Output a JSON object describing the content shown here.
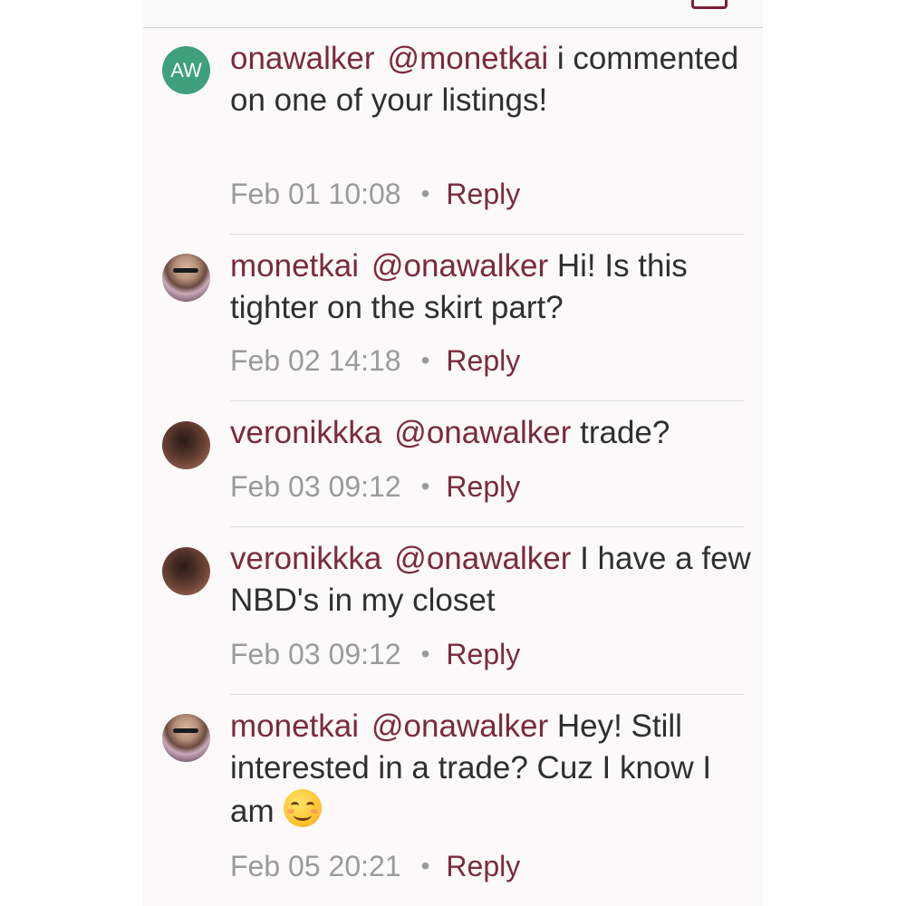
{
  "colors": {
    "accent": "#7a2a3e",
    "text": "#2f2f2f",
    "meta": "#9a9a9a",
    "avatar_initials_bg": "#3fa07e"
  },
  "header": {
    "icon": "box-icon"
  },
  "comments": [
    {
      "avatar": "AW",
      "username": "onawalker",
      "mention": "@monetkai",
      "message": "i commented on one of your listings!",
      "timestamp": "Feb 01 10:08",
      "reply_label": "Reply"
    },
    {
      "avatar": "user-photo",
      "username": "monetkai",
      "mention": "@onawalker",
      "message": "Hi! Is this tighter on the skirt part?",
      "timestamp": "Feb 02 14:18",
      "reply_label": "Reply"
    },
    {
      "avatar": "user-photo",
      "username": "veronikkka",
      "mention": "@onawalker",
      "message": "trade?",
      "timestamp": "Feb 03 09:12",
      "reply_label": "Reply"
    },
    {
      "avatar": "user-photo",
      "username": "veronikkka",
      "mention": "@onawalker",
      "message": "I have a few NBD's in my closet",
      "timestamp": "Feb 03 09:12",
      "reply_label": "Reply"
    },
    {
      "avatar": "user-photo",
      "username": "monetkai",
      "mention": "@onawalker",
      "message": "Hey! Still interested in a trade? Cuz I know I am",
      "emoji": "smiling-face-emoji",
      "timestamp": "Feb 05 20:21",
      "reply_label": "Reply"
    }
  ],
  "separator": "•"
}
